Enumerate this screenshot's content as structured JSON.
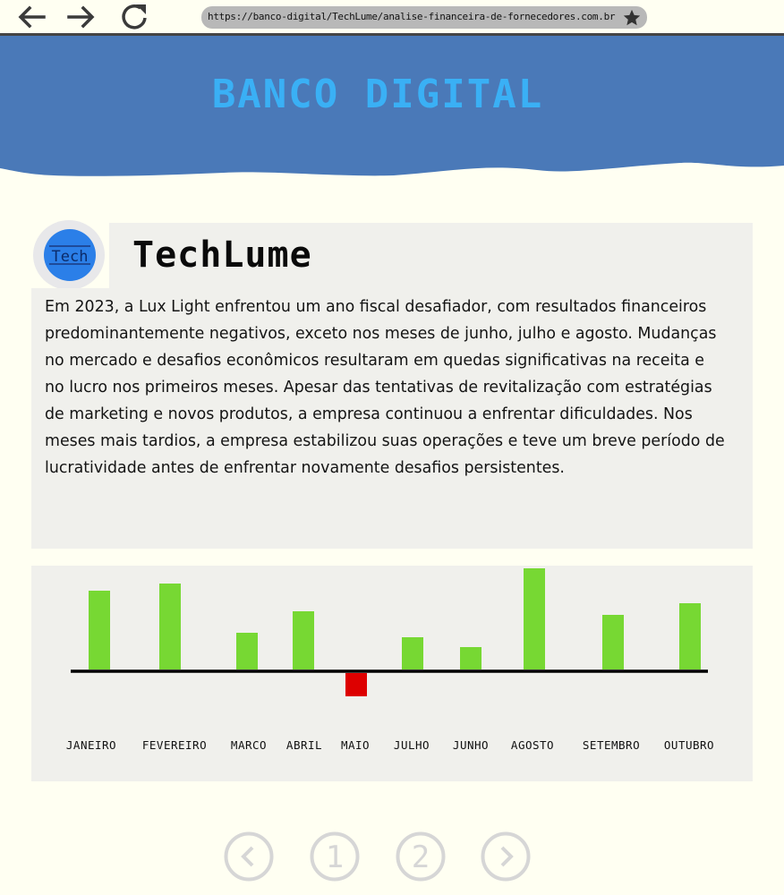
{
  "browser": {
    "url": "https://banco-digital/TechLume/analise-financeira-de-fornecedores.com.br",
    "back_icon": "arrow-left-icon",
    "forward_icon": "arrow-right-icon",
    "reload_icon": "reload-icon",
    "bookmark_icon": "star-icon"
  },
  "header": {
    "brand": "Banco Digital"
  },
  "company": {
    "name": "TechLume",
    "logo_text": "Tech",
    "description": "Em 2023, a Lux Light enfrentou um ano fiscal desafiador, com resultados financeiros predominantemente negativos, exceto nos meses de junho, julho e agosto. Mudanças no mercado e desafios econômicos resultaram em quedas significativas na receita e no lucro nos primeiros meses. Apesar das tentativas de revitalização com estratégias de marketing e novos produtos, a empresa continuou a enfrentar dificuldades. Nos meses mais tardios, a empresa estabilizou suas operações e teve um breve período de lucratividade antes de enfrentar novamente desafios persistentes."
  },
  "chart_data": {
    "type": "bar",
    "categories": [
      "JANEIRO",
      "FEVEREIRO",
      "MARCO",
      "ABRIL",
      "MAIO",
      "JULHO",
      "JUNHO",
      "AGOSTO",
      "SETEMBRO",
      "OUTUBRO"
    ],
    "values": [
      88,
      96,
      41,
      65,
      -26,
      36,
      25,
      113,
      61,
      74
    ],
    "title": "",
    "xlabel": "",
    "ylabel": "",
    "ylim": [
      -40,
      120
    ],
    "colors": {
      "positive": "#77d833",
      "negative": "#dd0000",
      "baseline": "#000000"
    },
    "grid": false,
    "legend": "none"
  },
  "pagination": {
    "prev_icon": "chevron-left-icon",
    "pages": [
      "1",
      "2"
    ],
    "next_icon": "chevron-right-icon"
  },
  "colors": {
    "banner": "#4a79b8",
    "brand_text": "#3ab0f5",
    "page_bg": "#fffff2",
    "panel_bg": "#f0f0ec",
    "pager_ring": "#d6d6d6"
  }
}
